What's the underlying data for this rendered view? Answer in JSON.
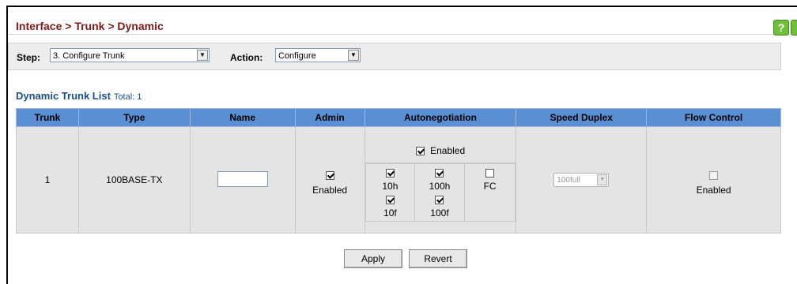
{
  "header": {
    "title": "Interface > Trunk > Dynamic"
  },
  "stepbar": {
    "step_label": "Step:",
    "step_value": "3. Configure Trunk",
    "action_label": "Action:",
    "action_value": "Configure"
  },
  "list": {
    "title": "Dynamic Trunk List",
    "total": "Total: 1"
  },
  "table": {
    "headers": {
      "trunk": "Trunk",
      "type": "Type",
      "name": "Name",
      "admin": "Admin",
      "autoneg": "Autonegotiation",
      "speed": "Speed Duplex",
      "flow": "Flow Control"
    },
    "row": {
      "trunk": "1",
      "type": "100BASE-TX",
      "name_value": "",
      "admin_label": "Enabled",
      "autoneg_enabled_label": "Enabled",
      "autoneg_10h": "10h",
      "autoneg_100h": "100h",
      "autoneg_fc": "FC",
      "autoneg_10f": "10f",
      "autoneg_100f": "100f",
      "speed_value": "100full",
      "flow_label": "Enabled"
    }
  },
  "buttons": {
    "apply": "Apply",
    "revert": "Revert"
  }
}
